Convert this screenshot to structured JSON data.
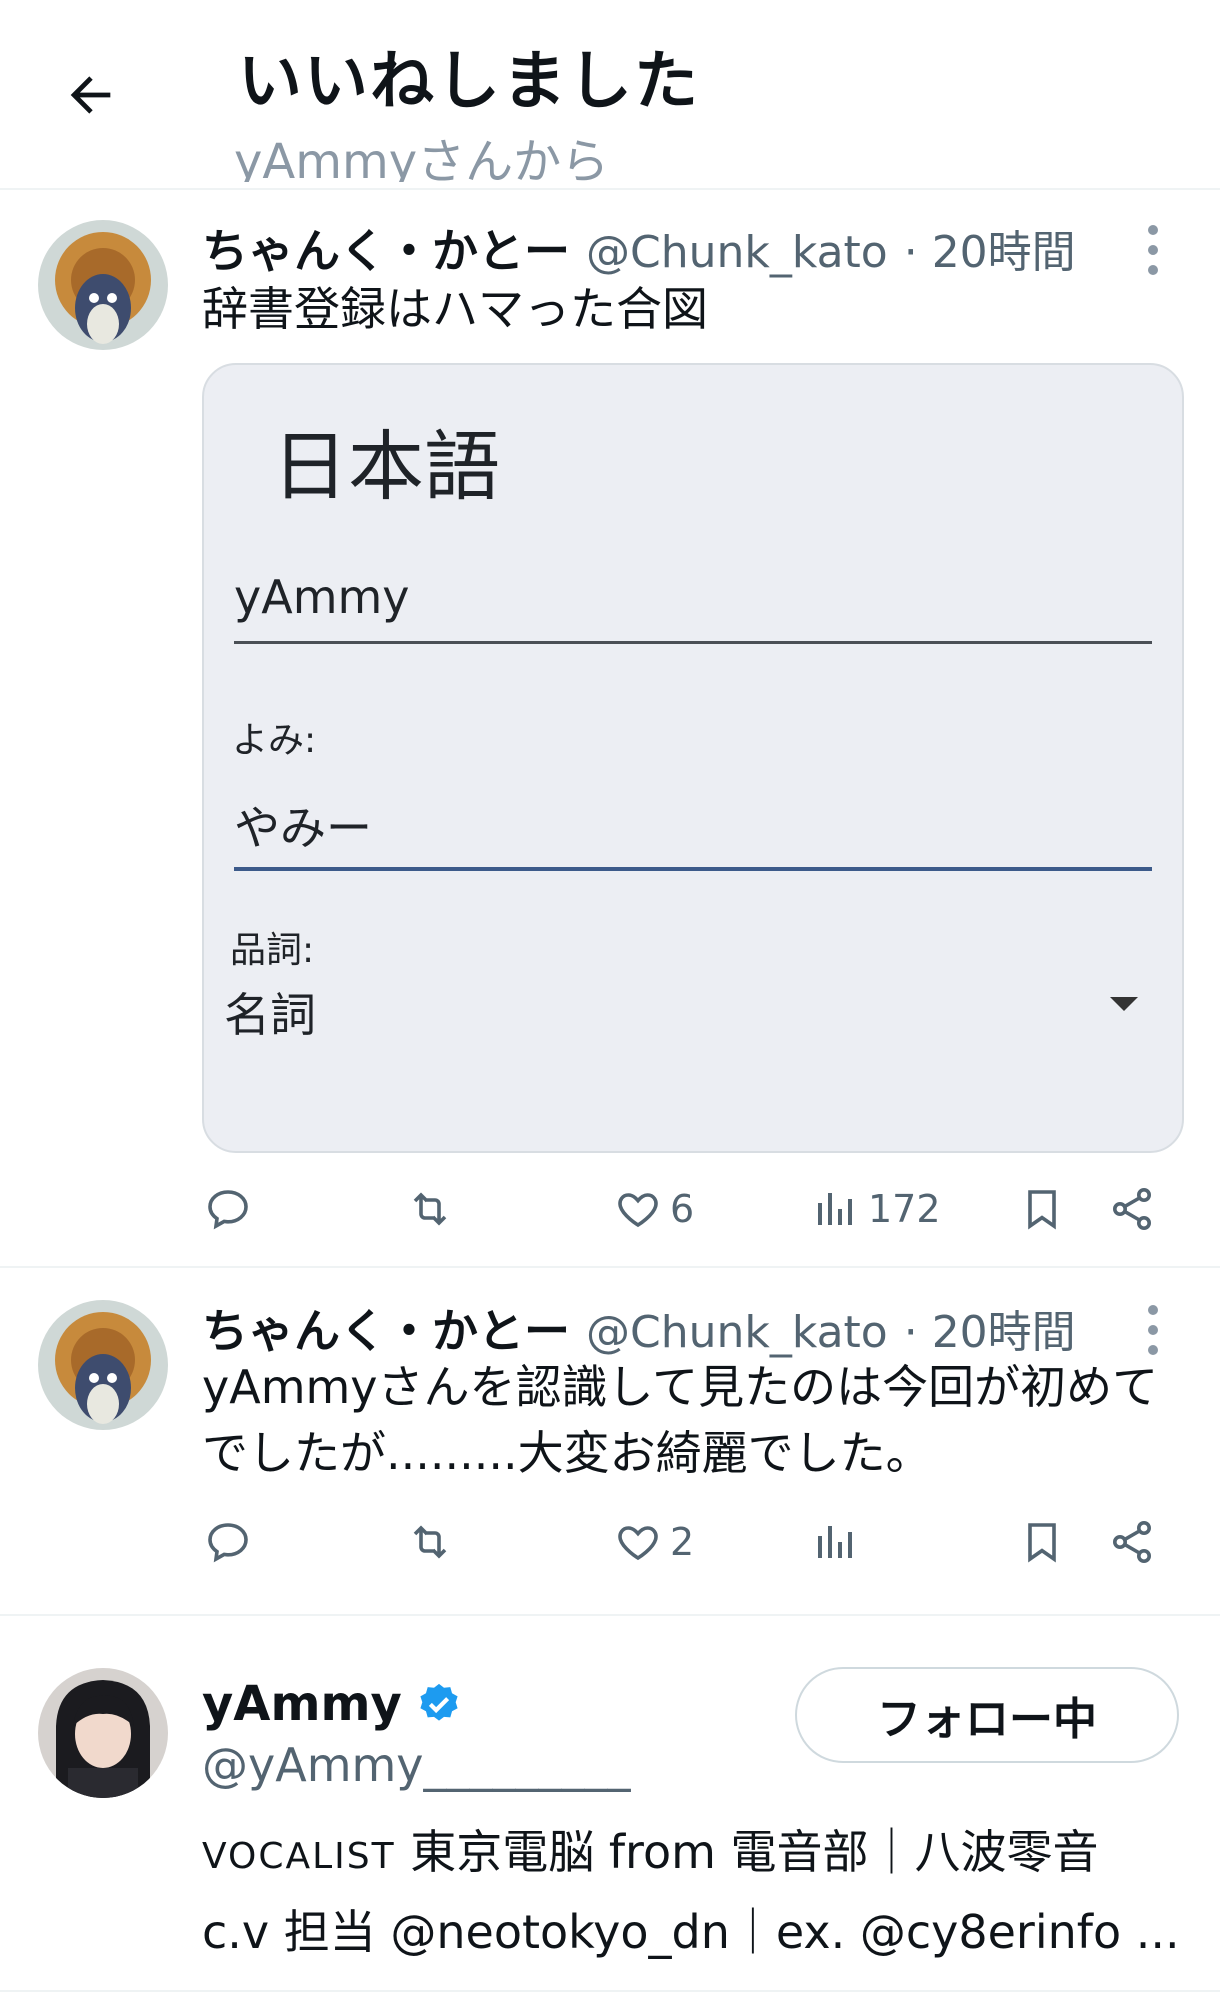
{
  "header": {
    "title": "いいねしました",
    "subtitle": "yAmmyさんから"
  },
  "tweets": [
    {
      "author_name": "ちゃんく・かとー",
      "handle": "@Chunk_kato",
      "time": "· 20時間",
      "text_lines": [
        "辞書登録はハマった合図"
      ],
      "image": {
        "title": "日本語",
        "word_value": "yAmmy",
        "reading_label": "よみ:",
        "reading_value": "やみー",
        "pos_label": "品詞:",
        "pos_value": "名詞"
      },
      "actions": {
        "replies": "",
        "retweets": "",
        "likes": "6",
        "views": "172"
      }
    },
    {
      "author_name": "ちゃんく・かとー",
      "handle": "@Chunk_kato",
      "time": "· 20時間",
      "text_lines": [
        "yAmmyさんを認識して見たのは今回が初めて",
        "でしたが.........大変お綺麗でした。"
      ],
      "actions": {
        "replies": "",
        "retweets": "",
        "likes": "2",
        "views": ""
      }
    }
  ],
  "user_card": {
    "name": "yAmmy",
    "handle": "@yAmmy_________",
    "follow_label": "フォロー中",
    "bio_line1_prefix": "VOCALIST",
    "bio_line1_rest": " 東京電脳 from 電音部｜八波零音",
    "bio_line2": "c.v 担当 @neotokyo_dn｜ex. @cy8erinfo ...",
    "verified_color": "#1d9bf0"
  }
}
